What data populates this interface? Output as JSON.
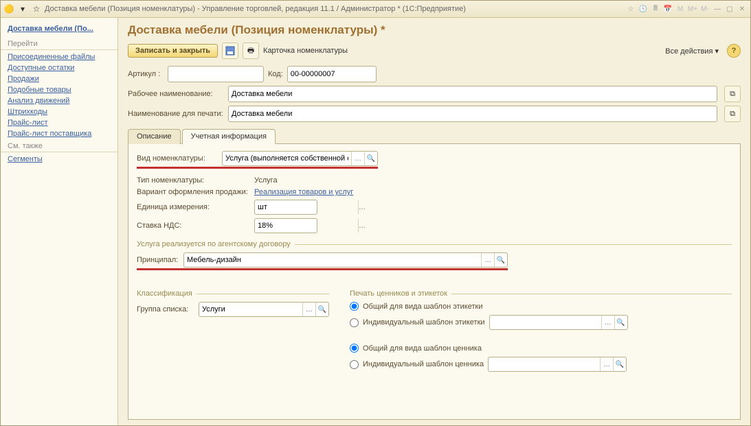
{
  "titlebar": {
    "title": "Доставка мебели (Позиция номенклатуры) - Управление торговлей, редакция 11.1 / Администратор * (1С:Предприятие)",
    "m_buttons": [
      "M",
      "M+",
      "M-"
    ]
  },
  "sidebar": {
    "title": "Доставка мебели (По...",
    "group1_head": "Перейти",
    "group1": [
      "Присоединенные файлы",
      "Доступные остатки",
      "Продажи",
      "Подобные товары",
      "Анализ движений",
      "Штрихкоды",
      "Прайс-лист",
      "Прайс-лист поставщика"
    ],
    "group2_head": "См. также",
    "group2": [
      "Сегменты"
    ]
  },
  "page": {
    "title": "Доставка мебели (Позиция номенклатуры) *",
    "save_close": "Записать и закрыть",
    "card_link": "Карточка номенклатуры",
    "all_actions": "Все действия ▾"
  },
  "fields": {
    "article_label": "Артикул :",
    "article": "",
    "code_label": "Код:",
    "code": "00-00000007",
    "work_name_label": "Рабочее наименование:",
    "work_name": "Доставка мебели",
    "print_name_label": "Наименование для печати:",
    "print_name": "Доставка мебели"
  },
  "tabs": {
    "t1": "Описание",
    "t2": "Учетная информация"
  },
  "acct": {
    "kind_label": "Вид номенклатуры:",
    "kind_value": "Услуга (выполняется собственной орга",
    "type_label": "Тип номенклатуры:",
    "type_value": "Услуга",
    "variant_label": "Вариант оформления продажи:",
    "variant_value": "Реализация товаров и услуг",
    "unit_label": "Единица измерения:",
    "unit_value": "шт",
    "vat_label": "Ставка НДС:",
    "vat_value": "18%",
    "agent_section": "Услуга реализуется по агентскому договору",
    "principal_label": "Принципал:",
    "principal_value": "Мебель-дизайн"
  },
  "classif": {
    "section": "Классификация",
    "group_label": "Группа списка:",
    "group_value": "Услуги"
  },
  "print_section": {
    "title": "Печать ценников и этикеток",
    "r1": "Общий для вида шаблон этикетки",
    "r2": "Индивидуальный шаблон этикетки",
    "r3": "Общий для вида шаблон ценника",
    "r4": "Индивидуальный шаблон ценника"
  }
}
